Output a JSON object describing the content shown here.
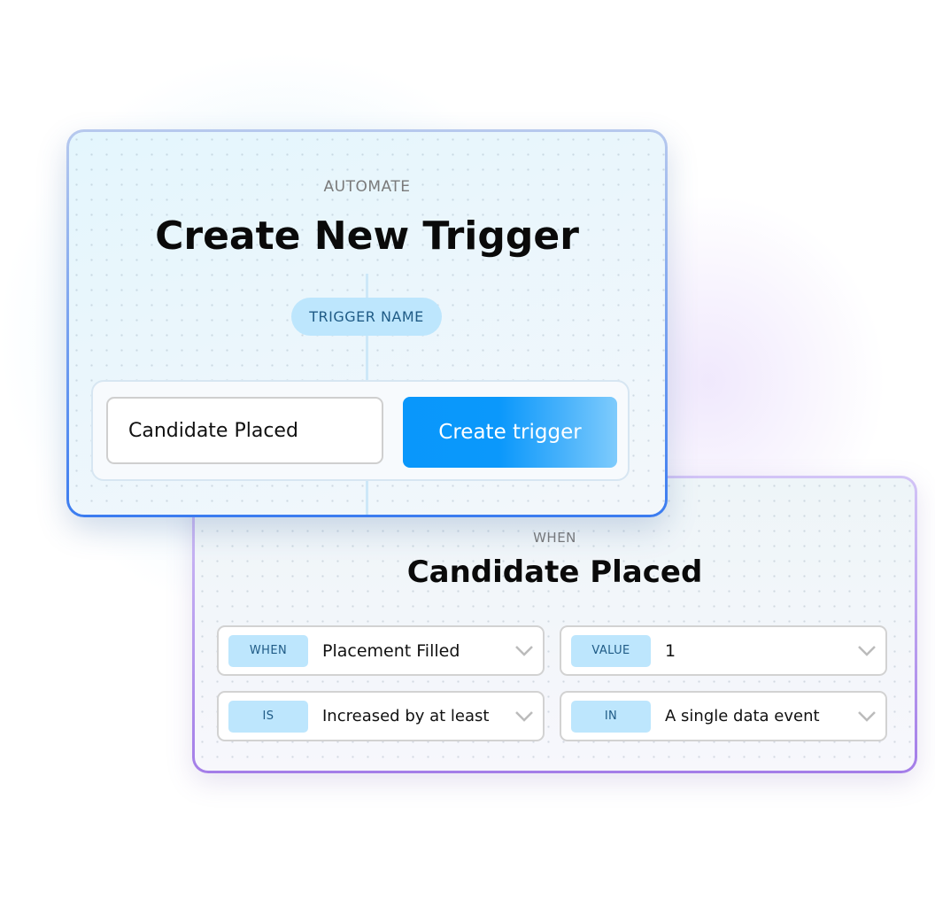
{
  "trigger_card": {
    "eyebrow": "AUTOMATE",
    "title": "Create New Trigger",
    "name_label": "TRIGGER NAME",
    "name_value": "Candidate Placed",
    "create_button": "Create trigger"
  },
  "condition_card": {
    "eyebrow": "WHEN",
    "title": "Candidate Placed",
    "fields": [
      {
        "label": "WHEN",
        "value": "Placement Filled",
        "icon": "chevron-down-icon"
      },
      {
        "label": "VALUE",
        "value": "1",
        "icon": "chevron-down-icon"
      },
      {
        "label": "IS",
        "value": "Increased by at least",
        "icon": "chevron-down-icon"
      },
      {
        "label": "IN",
        "value": "A single data event",
        "icon": "chevron-down-icon"
      }
    ]
  },
  "colors": {
    "accent": "#0997fb",
    "badge_bg": "#bde6fd",
    "badge_text": "#1f5b86",
    "card1_border": "#3b7cf0",
    "card2_border": "#a47de8"
  }
}
